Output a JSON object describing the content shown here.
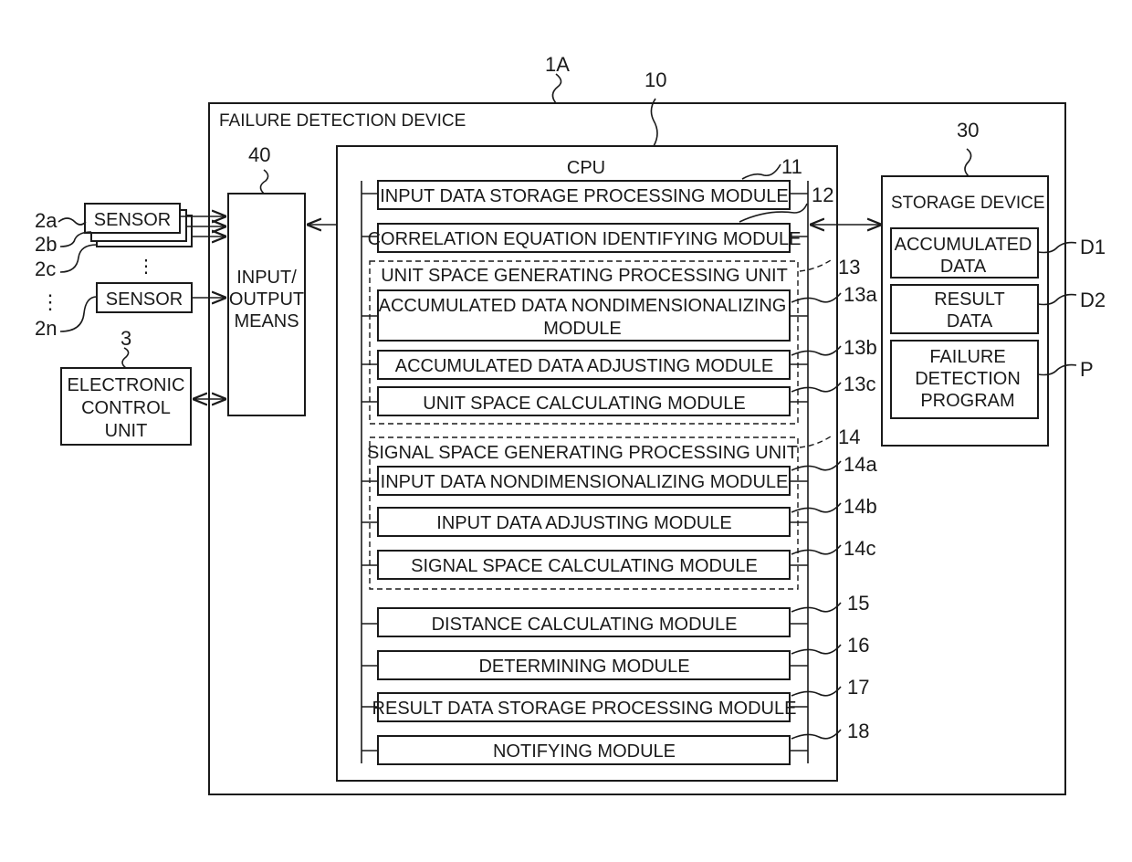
{
  "diagram": {
    "device": {
      "ref": "1A",
      "label": "FAILURE DETECTION DEVICE"
    },
    "io": {
      "ref": "40",
      "lines": [
        "INPUT/",
        "OUTPUT",
        "MEANS"
      ]
    },
    "sensors": [
      {
        "ref": "2a",
        "label": "SENSOR"
      },
      {
        "ref": "2b",
        "label": "SENSOR"
      },
      {
        "ref": "2c",
        "label": "SENSOR"
      },
      {
        "ref": "2n",
        "label": "SENSOR"
      }
    ],
    "ecu": {
      "ref": "3",
      "lines": [
        "ELECTRONIC",
        "CONTROL",
        "UNIT"
      ]
    },
    "cpu": {
      "ref": "10",
      "label": "CPU",
      "modules": [
        {
          "ref": "11",
          "label": "INPUT DATA STORAGE PROCESSING MODULE"
        },
        {
          "ref": "12",
          "label": "CORRELATION EQUATION IDENTIFYING MODULE"
        }
      ],
      "unit_space": {
        "ref": "13",
        "label": "UNIT SPACE GENERATING PROCESSING UNIT",
        "modules": [
          {
            "ref": "13a",
            "lines": [
              "ACCUMULATED DATA NONDIMENSIONALIZING",
              "MODULE"
            ]
          },
          {
            "ref": "13b",
            "label": "ACCUMULATED DATA ADJUSTING MODULE"
          },
          {
            "ref": "13c",
            "label": "UNIT SPACE CALCULATING MODULE"
          }
        ]
      },
      "signal_space": {
        "ref": "14",
        "label": "SIGNAL SPACE GENERATING PROCESSING UNIT",
        "modules": [
          {
            "ref": "14a",
            "label": "INPUT DATA NONDIMENSIONALIZING MODULE"
          },
          {
            "ref": "14b",
            "label": "INPUT DATA ADJUSTING MODULE"
          },
          {
            "ref": "14c",
            "label": "SIGNAL SPACE CALCULATING MODULE"
          }
        ]
      },
      "tail_modules": [
        {
          "ref": "15",
          "label": "DISTANCE CALCULATING MODULE"
        },
        {
          "ref": "16",
          "label": "DETERMINING MODULE"
        },
        {
          "ref": "17",
          "label": "RESULT DATA STORAGE PROCESSING MODULE"
        },
        {
          "ref": "18",
          "label": "NOTIFYING MODULE"
        }
      ]
    },
    "storage": {
      "ref": "30",
      "label": "STORAGE DEVICE",
      "items": [
        {
          "ref": "D1",
          "lines": [
            "ACCUMULATED",
            "DATA"
          ]
        },
        {
          "ref": "D2",
          "lines": [
            "RESULT",
            "DATA"
          ]
        },
        {
          "ref": "P",
          "lines": [
            "FAILURE",
            "DETECTION",
            "PROGRAM"
          ]
        }
      ]
    },
    "ellipsis": "⋮"
  }
}
